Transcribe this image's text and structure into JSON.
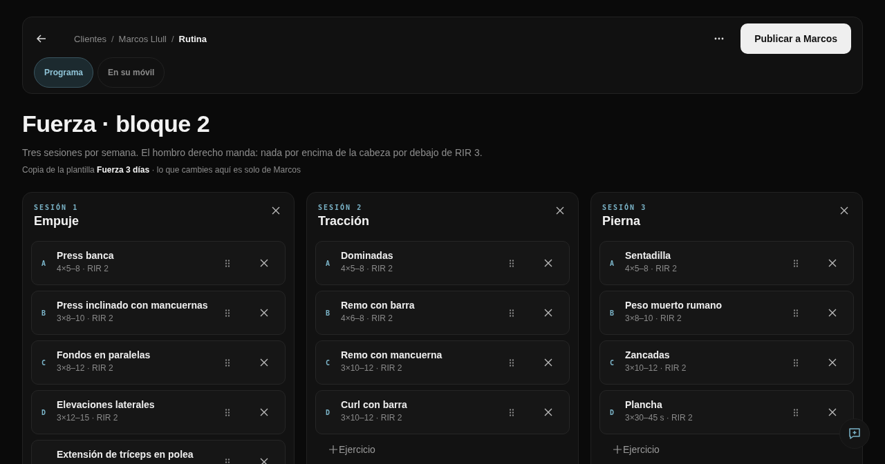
{
  "header": {
    "breadcrumb": [
      {
        "label": "Clientes",
        "current": false
      },
      {
        "label": "Marcos Llull",
        "current": false
      },
      {
        "label": "Rutina",
        "current": true
      }
    ],
    "breadcrumb_separator": "/",
    "publish_button": "Publicar a Marcos"
  },
  "tabs": [
    {
      "label": "Programa",
      "selected": true
    },
    {
      "label": "En su móvil",
      "selected": false
    }
  ],
  "title": "Fuerza · bloque 2",
  "description": "Tres sesiones por semana. El hombro derecho manda: nada por encima de la cabeza por debajo de RIR 3.",
  "note": "Copia de la plantilla **Fuerza 3 días** · lo que cambies aquí es solo de Marcos",
  "sessions": [
    {
      "label": "SESIÓN 1",
      "name": "Empuje",
      "exercises": [
        {
          "letter": "A",
          "name": "Press banca",
          "sets": "4×5–8 · RIR 2"
        },
        {
          "letter": "B",
          "name": "Press inclinado con mancuernas",
          "sets": "3×8–10 · RIR 2"
        },
        {
          "letter": "C",
          "name": "Fondos en paralelas",
          "sets": "3×8–12 · RIR 2"
        },
        {
          "letter": "D",
          "name": "Elevaciones laterales",
          "sets": "3×12–15 · RIR 2"
        },
        {
          "name": "Extensión de tríceps en polea"
        }
      ]
    },
    {
      "label": "SESIÓN 2",
      "name": "Tracción",
      "add_button": "Ejercicio",
      "exercises": [
        {
          "letter": "A",
          "name": "Dominadas",
          "sets": "4×5–8 · RIR 2"
        },
        {
          "letter": "B",
          "name": "Remo con barra",
          "sets": "4×6–8 · RIR 2"
        },
        {
          "letter": "C",
          "name": "Remo con mancuerna",
          "sets": "3×10–12 · RIR 2"
        },
        {
          "letter": "D",
          "name": "Curl con barra",
          "sets": "3×10–12 · RIR 2"
        }
      ]
    },
    {
      "label": "SESIÓN 3",
      "name": "Pierna",
      "add_button": "Ejercicio",
      "exercises": [
        {
          "letter": "A",
          "name": "Sentadilla",
          "sets": "4×5–8 · RIR 2"
        },
        {
          "letter": "B",
          "name": "Peso muerto rumano",
          "sets": "3×8–10 · RIR 2"
        },
        {
          "letter": "C",
          "name": "Zancadas",
          "sets": "3×10–12 · RIR 2"
        },
        {
          "letter": "D",
          "name": "Plancha",
          "sets": "3×30–45 s · RIR 2"
        }
      ]
    }
  ]
}
